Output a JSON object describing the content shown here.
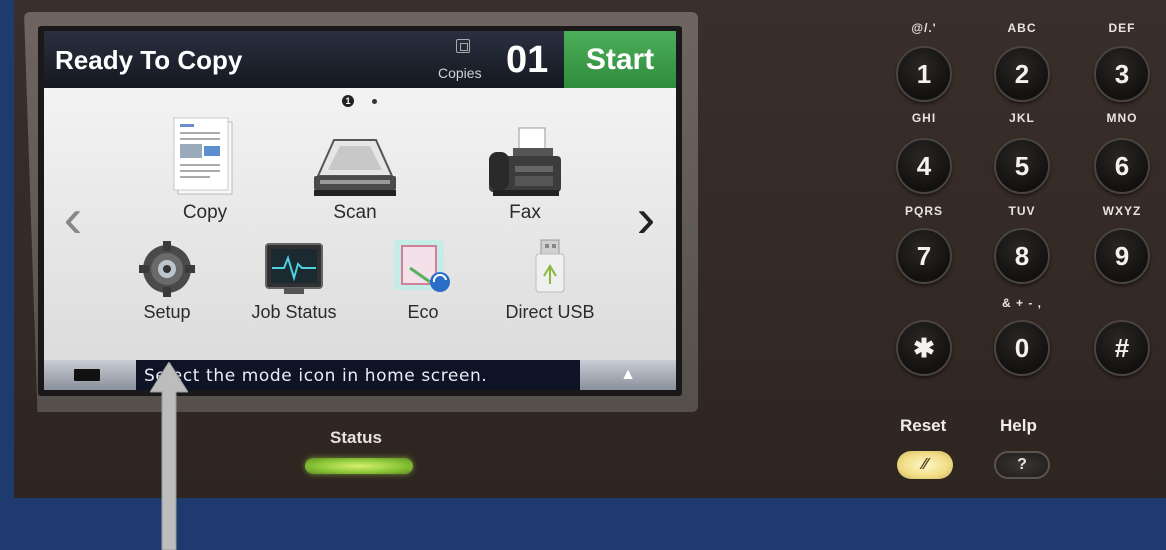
{
  "screen": {
    "title": "Ready To Copy",
    "copies_label": "Copies",
    "copies_count": "01",
    "start_label": "Start",
    "page_indicator_active": "1",
    "prev_arrow": "‹",
    "next_arrow": "›",
    "apps_row1": [
      {
        "label": "Copy",
        "icon": "copy-icon"
      },
      {
        "label": "Scan",
        "icon": "scan-icon"
      },
      {
        "label": "Fax",
        "icon": "fax-icon"
      }
    ],
    "apps_row2": [
      {
        "label": "Setup",
        "icon": "gear-icon"
      },
      {
        "label": "Job Status",
        "icon": "monitor-icon"
      },
      {
        "label": "Eco",
        "icon": "eco-icon"
      },
      {
        "label": "Direct USB",
        "icon": "usb-icon"
      }
    ],
    "message": "Select the mode icon in home screen.",
    "expand_symbol": "▲"
  },
  "panel": {
    "status_label": "Status",
    "keypad": [
      {
        "letters": "@/.'",
        "digit": "1"
      },
      {
        "letters": "ABC",
        "digit": "2"
      },
      {
        "letters": "DEF",
        "digit": "3"
      },
      {
        "letters": "GHI",
        "digit": "4"
      },
      {
        "letters": "JKL",
        "digit": "5"
      },
      {
        "letters": "MNO",
        "digit": "6"
      },
      {
        "letters": "PQRS",
        "digit": "7"
      },
      {
        "letters": "TUV",
        "digit": "8"
      },
      {
        "letters": "WXYZ",
        "digit": "9"
      },
      {
        "letters": "",
        "digit": "✱"
      },
      {
        "letters": "& + - ,",
        "digit": "0"
      },
      {
        "letters": "",
        "digit": "#"
      }
    ],
    "reset_label": "Reset",
    "reset_symbol": "⁄⁄",
    "help_label": "Help",
    "help_symbol": "?"
  },
  "colors": {
    "background": "#1e3a6e",
    "start_green": "#3a9e48",
    "status_led": "#8cc838",
    "reset_yellow": "#f0dc84"
  }
}
